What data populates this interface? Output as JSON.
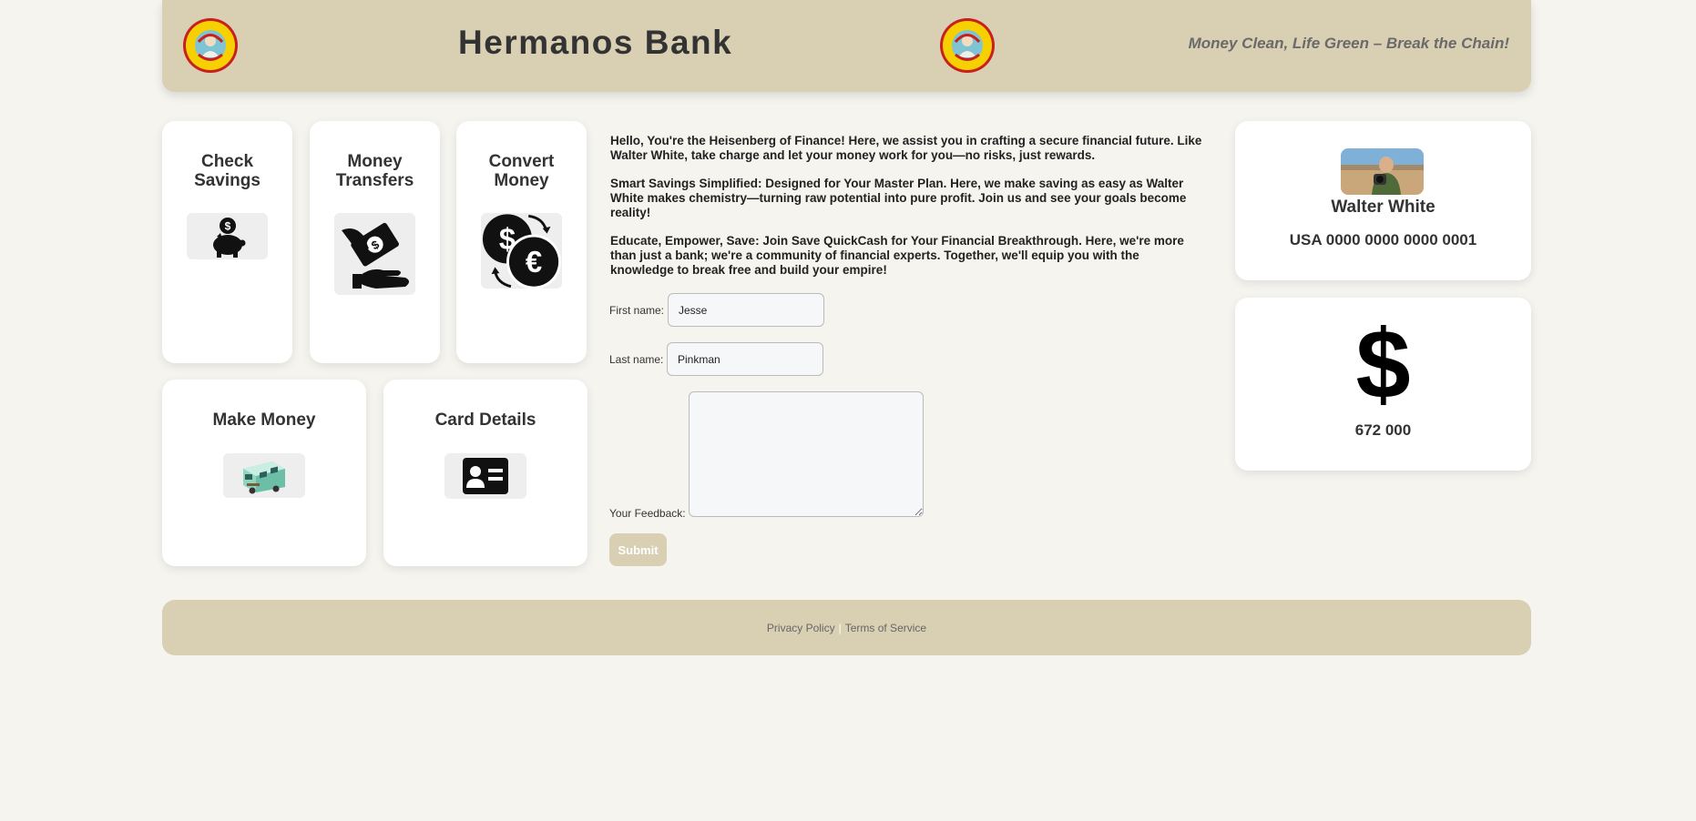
{
  "header": {
    "title": "Hermanos Bank",
    "tagline": "Money Clean, Life Green – Break the Chain!",
    "logo_text_top": "LOS POLLOS",
    "logo_text_bottom": "HERMANOS"
  },
  "services": [
    {
      "title": "Check Savings",
      "icon": "piggy-bank-icon"
    },
    {
      "title": "Money Transfers",
      "icon": "money-transfer-icon"
    },
    {
      "title": "Convert Money",
      "icon": "currency-exchange-icon"
    },
    {
      "title": "Make Money",
      "icon": "rv-camper-icon"
    },
    {
      "title": "Card Details",
      "icon": "id-card-icon"
    }
  ],
  "intro": {
    "p1": "Hello, You're the Heisenberg of Finance! Here, we assist you in crafting a secure financial future. Like Walter White, take charge and let your money work for you—no risks, just rewards.",
    "p2": "Smart Savings Simplified: Designed for Your Master Plan. Here, we make saving as easy as Walter White makes chemistry—turning raw potential into pure profit. Join us and see your goals become reality!",
    "p3": "Educate, Empower, Save: Join Save QuickCash for Your Financial Breakthrough. Here, we're more than just a bank; we're a community of financial experts. Together, we'll equip you with the knowledge to break free and build your empire!"
  },
  "form": {
    "first_name_label": "First name:",
    "first_name_value": "Jesse",
    "last_name_label": "Last name:",
    "last_name_value": "Pinkman",
    "feedback_label": "Your Feedback:",
    "feedback_value": "",
    "submit_label": "Submit"
  },
  "profile": {
    "name": "Walter White",
    "account": "USA 0000 0000 0000 0001"
  },
  "balance": {
    "symbol": "$",
    "amount": "672 000"
  },
  "footer": {
    "privacy": "Privacy Policy",
    "separator": "|",
    "terms": "Terms of Service"
  },
  "colors": {
    "header_bg": "#d9cfb3",
    "page_bg": "#f5f4ef",
    "card_bg": "#ffffff"
  }
}
